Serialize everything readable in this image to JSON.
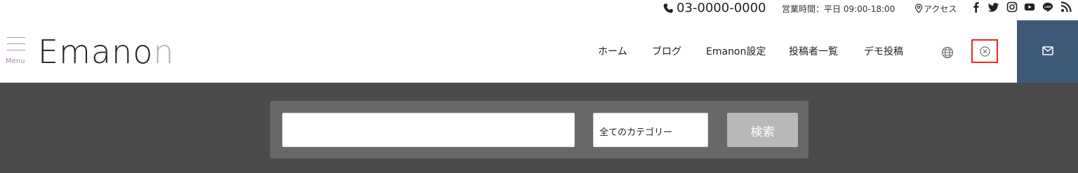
{
  "topbar": {
    "phone": "03-0000-0000",
    "hours": "営業時間：平日 09:00-18:00",
    "access": "アクセス",
    "social_icons": [
      "facebook-icon",
      "twitter-icon",
      "instagram-icon",
      "youtube-icon",
      "line-icon",
      "rss-icon"
    ]
  },
  "header": {
    "menu_label": "Menu",
    "logo": {
      "dark": "Emano",
      "light": "n"
    },
    "nav": [
      "ホーム",
      "ブログ",
      "Emanon設定",
      "投稿者一覧",
      "デモ投稿"
    ],
    "icons": [
      "globe-icon",
      "close-icon",
      "mail-icon"
    ],
    "accent_color": "#3e5a78",
    "highlight_color": "#e8291c"
  },
  "search": {
    "input_value": "",
    "category": "全てのカテゴリー",
    "button": "検索"
  }
}
